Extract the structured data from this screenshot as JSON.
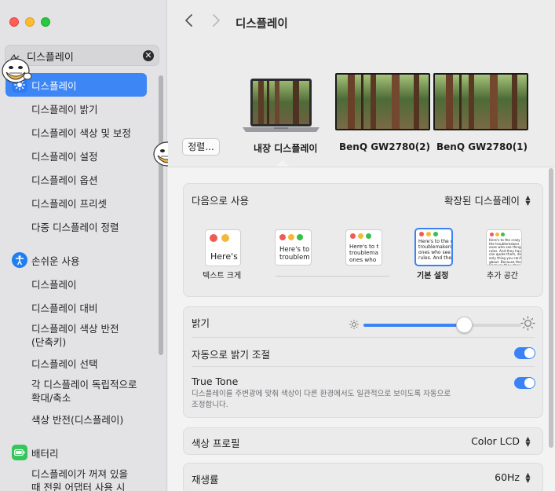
{
  "colors": {
    "accent": "#3a82f6",
    "sidebar_selection": "#3d86f6"
  },
  "search": {
    "value": "디스플레이"
  },
  "sidebar": {
    "selected": "디스플레이",
    "display_items": [
      "디스플레이 밝기",
      "디스플레이 색상 및 보정",
      "디스플레이 설정",
      "디스플레이 옵션",
      "디스플레이 프리셋",
      "다중 디스플레이 정렬"
    ],
    "accessibility": {
      "label": "손쉬운 사용",
      "items": [
        "디스플레이",
        "디스플레이 대비",
        "디스플레이 색상 반전\n(단축키)",
        "디스플레이 선택",
        "각 디스플레이 독립적으로\n확대/축소",
        "색상 반전(디스플레이)"
      ]
    },
    "battery": {
      "label": "배터리",
      "items": [
        "디스플레이가 꺼져 있을\n때 전원 어댑터 사용 시"
      ]
    }
  },
  "toolbar": {
    "title": "디스플레이"
  },
  "displays": {
    "arrange_label": "정렬...",
    "items": [
      {
        "label": "내장 디스플레이",
        "icon": "laptop-icon"
      },
      {
        "label": "BenQ GW2780(2)",
        "icon": "monitor-icon"
      },
      {
        "label": "BenQ GW2780(1)",
        "icon": "monitor-icon"
      }
    ]
  },
  "use_as": {
    "label": "다음으로 사용",
    "value": "확장된 디스플레이"
  },
  "resolution": {
    "options": [
      {
        "caption": "텍스트 크게",
        "preview_text": "Here's",
        "selected": false
      },
      {
        "caption": "",
        "preview_text": "Here's to\ntroublem",
        "selected": false
      },
      {
        "caption": "",
        "preview_text": "Here's to t\ntroublema\nones who",
        "selected": false
      },
      {
        "caption": "기본 설정",
        "preview_text": "Here's to the cr\ntroublemakers.\nones who see th\nrules. And they",
        "selected": true
      },
      {
        "caption": "추가 공간",
        "preview_text": "Here's to the crazy ones\nthe troublemakers. The\nones who see things diff\nrules. And they have no\ncan quote them, disagree\nonly thing you can't do\nabout. Because they cha\nBecause they change",
        "selected": false
      }
    ]
  },
  "brightness": {
    "label": "밝기",
    "value": 0.64
  },
  "auto_brightness": {
    "label": "자동으로 밝기 조절",
    "on": true
  },
  "true_tone": {
    "label": "True Tone",
    "description": "디스플레이를 주변광에 맞춰 색상이 다른 환경에서도 일관적으로 보이도록 자동으로\n조정합니다.",
    "on": true
  },
  "color_profile": {
    "label": "색상 프로필",
    "value": "Color LCD"
  },
  "refresh_rate": {
    "label": "재생률",
    "value": "60Hz"
  }
}
